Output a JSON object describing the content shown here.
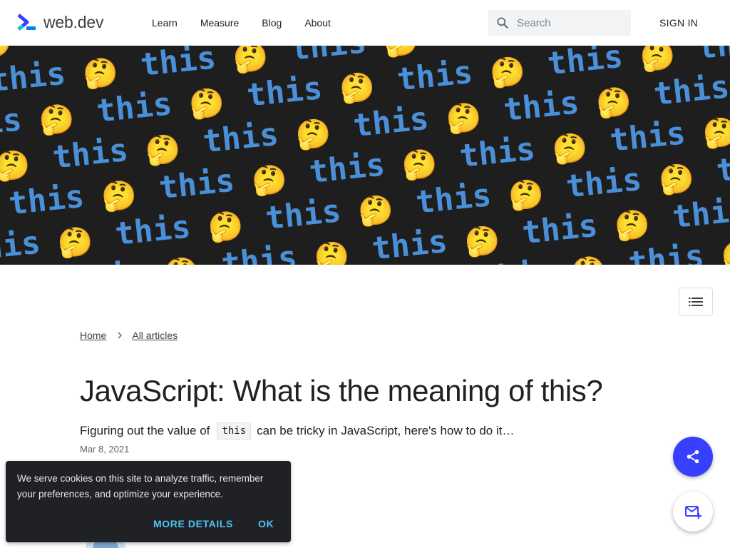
{
  "header": {
    "logo_text": "web.dev",
    "nav": [
      "Learn",
      "Measure",
      "Blog",
      "About"
    ],
    "search_placeholder": "Search",
    "signin_label": "SIGN IN"
  },
  "hero": {
    "pattern_word": "this",
    "emoji": "🤔",
    "background_color": "#1e1e1e",
    "text_color": "#4a90d9"
  },
  "breadcrumb": {
    "items": [
      "Home",
      "All articles"
    ]
  },
  "article": {
    "title": "JavaScript: What is the meaning of this?",
    "subtitle_before": "Figuring out the value of",
    "subtitle_code": "this",
    "subtitle_after": "can be tricky in JavaScript, here's how to do it…",
    "date": "Mar 8, 2021"
  },
  "cookie_banner": {
    "text": "We serve cookies on this site to analyze traffic, remember your preferences, and optimize your experience.",
    "more_label": "MORE DETAILS",
    "ok_label": "OK"
  },
  "colors": {
    "accent": "#3740ff",
    "cookie_link": "#4fc3f7"
  },
  "icons": [
    "logo-icon",
    "search-icon",
    "chevron-right-icon",
    "toc-list-icon",
    "share-icon",
    "mail-add-icon"
  ]
}
